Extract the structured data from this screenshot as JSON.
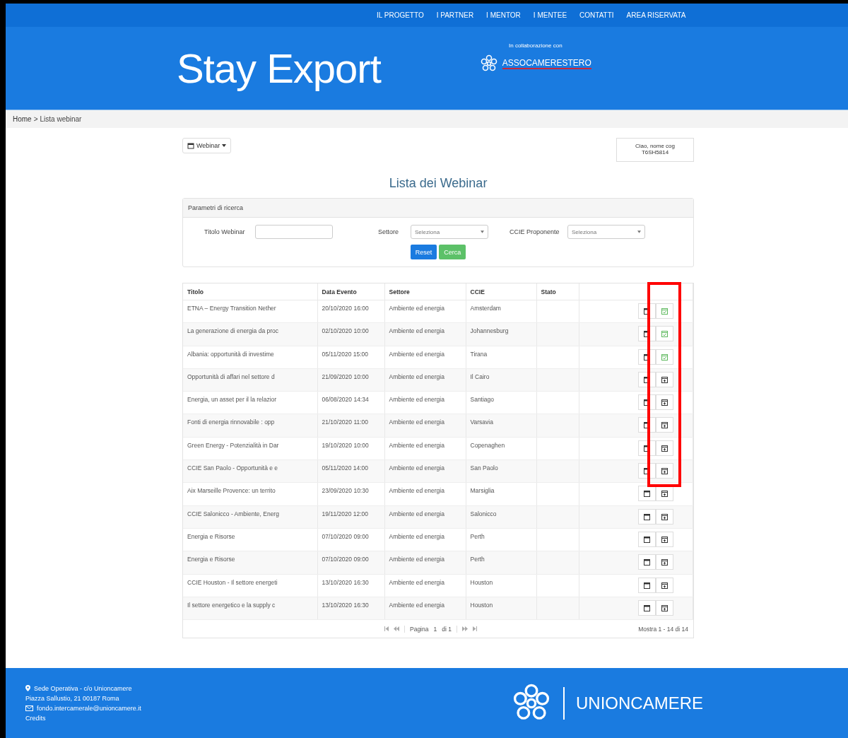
{
  "nav": [
    "IL PROGETTO",
    "I PARTNER",
    "I MENTOR",
    "I MENTEE",
    "CONTATTI",
    "AREA RISERVATA"
  ],
  "header": {
    "title": "Stay Export",
    "collab_label": "In collaborazione con",
    "partner": "ASSOCAMERESTERO"
  },
  "breadcrumb": {
    "home": "Home",
    "separator": ">",
    "current": "Lista webinar"
  },
  "menu_button": "Webinar",
  "user_menu": "Ciao, nome cog T6SH5814",
  "page_title": "Lista dei Webinar",
  "search": {
    "title": "Parametri di ricerca",
    "title_label": "Titolo Webinar",
    "sector_label": "Settore",
    "sector_placeholder": "Seleziona",
    "ccie_label": "CCIE Proponente",
    "ccie_placeholder": "Seleziona",
    "reset": "Reset",
    "search": "Cerca"
  },
  "table": {
    "columns": [
      "Titolo",
      "Data Evento",
      "Settore",
      "CCIE",
      "Stato"
    ],
    "rows": [
      {
        "title": "ETNA – Energy Transition Nether",
        "date": "20/10/2020 16:00",
        "sector": "Ambiente ed energia",
        "ccie": "Amsterdam",
        "registered": true
      },
      {
        "title": "La generazione di energia da proc",
        "date": "02/10/2020 10:00",
        "sector": "Ambiente ed energia",
        "ccie": "Johannesburg",
        "registered": true
      },
      {
        "title": "Albania: opportunità di investime",
        "date": "05/11/2020 15:00",
        "sector": "Ambiente ed energia",
        "ccie": "Tirana",
        "registered": true
      },
      {
        "title": "Opportunità di affari nel settore d",
        "date": "21/09/2020 10:00",
        "sector": "Ambiente ed energia",
        "ccie": "Il Cairo",
        "registered": false
      },
      {
        "title": "Energia, un asset per il la relazior",
        "date": "06/08/2020 14:34",
        "sector": "Ambiente ed energia",
        "ccie": "Santiago",
        "registered": false
      },
      {
        "title": "Fonti di energia rinnovabile :  opp",
        "date": "21/10/2020 11:00",
        "sector": "Ambiente ed energia",
        "ccie": "Varsavia",
        "registered": false
      },
      {
        "title": "Green Energy - Potenzialità in Dar",
        "date": "19/10/2020 10:00",
        "sector": "Ambiente ed energia",
        "ccie": "Copenaghen",
        "registered": false
      },
      {
        "title": "CCIE San Paolo - Opportunità e e",
        "date": "05/11/2020 14:00",
        "sector": "Ambiente ed energia",
        "ccie": "San Paolo",
        "registered": false
      },
      {
        "title": "Aix Marseille Provence: un territo",
        "date": "23/09/2020 10:30",
        "sector": "Ambiente ed energia",
        "ccie": "Marsiglia",
        "registered": false
      },
      {
        "title": "CCIE Salonicco - Ambiente, Energ",
        "date": "19/11/2020 12:00",
        "sector": "Ambiente ed energia",
        "ccie": "Salonicco",
        "registered": false
      },
      {
        "title": "Energia e Risorse",
        "date": "07/10/2020 09:00",
        "sector": "Ambiente ed energia",
        "ccie": "Perth",
        "registered": false
      },
      {
        "title": "Energia e Risorse",
        "date": "07/10/2020 09:00",
        "sector": "Ambiente ed energia",
        "ccie": "Perth",
        "registered": false
      },
      {
        "title": "CCIE Houston - Il settore energeti",
        "date": "13/10/2020 16:30",
        "sector": "Ambiente ed energia",
        "ccie": "Houston",
        "registered": false
      },
      {
        "title": "Il settore energetico e la supply c",
        "date": "13/10/2020 16:30",
        "sector": "Ambiente ed energia",
        "ccie": "Houston",
        "registered": false
      }
    ]
  },
  "annotation": {
    "kind": "highlight"
  },
  "pager": {
    "page_label": "Pagina",
    "page": "1",
    "of": "di 1",
    "summary": "Mostra 1 - 14 di 14"
  },
  "footer": {
    "address_title": "Sede Operativa - c/o Unioncamere",
    "address": "Piazza Sallustio, 21 00187 Roma",
    "email": "fondo.intercamerale@unioncamere.it",
    "credits": "Credits",
    "logo": "UNIONCAMERE"
  }
}
